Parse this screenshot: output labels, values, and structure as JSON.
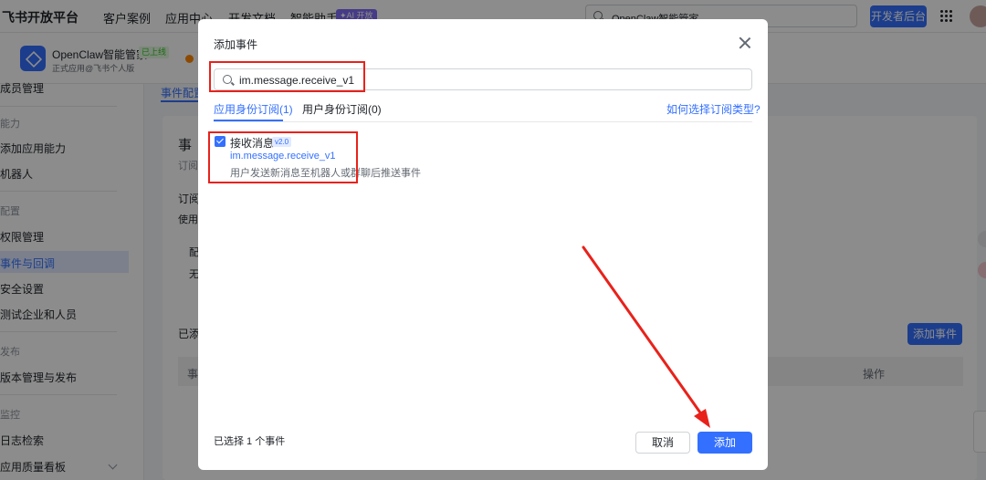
{
  "topnav": {
    "brand": "飞书开放平台",
    "items": [
      "客户案例",
      "应用中心",
      "开发文档",
      "智能助手"
    ],
    "ai_badge": "✦AI 开放",
    "search_value": "OpenClaw智能管家",
    "dev_console": "开发者后台"
  },
  "app": {
    "name": "OpenClaw智能管家",
    "status": "已上线",
    "subtitle": "正式应用@飞书个人版"
  },
  "sidebar": {
    "items": [
      {
        "type": "item",
        "label": "成员管理"
      },
      {
        "type": "group",
        "label": "能力"
      },
      {
        "type": "item",
        "label": "添加应用能力"
      },
      {
        "type": "item",
        "label": "机器人"
      },
      {
        "type": "group",
        "label": "配置"
      },
      {
        "type": "item",
        "label": "权限管理"
      },
      {
        "type": "item",
        "label": "事件与回调"
      },
      {
        "type": "item",
        "label": "安全设置"
      },
      {
        "type": "item",
        "label": "测试企业和人员"
      },
      {
        "type": "group",
        "label": "发布"
      },
      {
        "type": "item",
        "label": "版本管理与发布"
      },
      {
        "type": "group",
        "label": "监控"
      },
      {
        "type": "item",
        "label": "日志检索"
      },
      {
        "type": "item",
        "label": "应用质量看板"
      }
    ]
  },
  "background": {
    "tab_label": "事件配置",
    "card_title": "事",
    "card_sub": "订阅",
    "sec1": "订阅",
    "sec1_sub": "使用",
    "box1": "配",
    "box2": "无",
    "added": "已添",
    "add_event_button": "添加事件",
    "table_col": "事",
    "table_op": "操作"
  },
  "modal": {
    "title": "添加事件",
    "search_value": "im.message.receive_v1",
    "tabs": [
      {
        "label": "应用身份订阅(1)",
        "active": true
      },
      {
        "label": "用户身份订阅(0)",
        "active": false
      }
    ],
    "help_link": "如何选择订阅类型?",
    "event": {
      "name": "接收消息",
      "version": "v2.0",
      "key": "im.message.receive_v1",
      "description": "用户发送新消息至机器人或群聊后推送事件",
      "checked": true
    },
    "selected_count": "已选择 1 个事件",
    "cancel_label": "取消",
    "add_label": "添加"
  },
  "colors": {
    "accent": "#3370ff",
    "annotation": "#e8221b"
  }
}
